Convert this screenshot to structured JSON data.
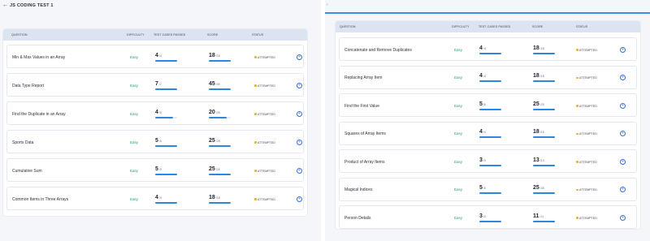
{
  "accent": "#2f86de",
  "header": {
    "back_icon": "arrow-left-icon",
    "title": "JS CODING TEST 1"
  },
  "columns": {
    "question": "QUESTION",
    "difficulty": "DIFFICULTY",
    "test_cases": "TEST CASES PASSED",
    "score": "SCORE",
    "status": "STATUS"
  },
  "left_rows": [
    {
      "question": "Min & Max Values in an Array",
      "difficulty": "Easy",
      "passed": "4",
      "total": "/4",
      "score": "18",
      "score_total": "/18",
      "progress": 1.0,
      "status": "ATTEMPTED"
    },
    {
      "question": "Data Type Report",
      "difficulty": "Easy",
      "passed": "7",
      "total": "/7",
      "score": "45",
      "score_total": "/45",
      "progress": 1.0,
      "status": "ATTEMPTED"
    },
    {
      "question": "Find the Duplicate in an Array",
      "difficulty": "Easy",
      "passed": "4",
      "total": "/5",
      "score": "20",
      "score_total": "/25",
      "progress": 0.8,
      "status": "ATTEMPTED"
    },
    {
      "question": "Sports Data",
      "difficulty": "Easy",
      "passed": "5",
      "total": "/5",
      "score": "25",
      "score_total": "/25",
      "progress": 1.0,
      "status": "ATTEMPTED"
    },
    {
      "question": "Cumulative Sum",
      "difficulty": "Easy",
      "passed": "5",
      "total": "/5",
      "score": "25",
      "score_total": "/25",
      "progress": 1.0,
      "status": "ATTEMPTED"
    },
    {
      "question": "Common Items in Three Arrays",
      "difficulty": "Easy",
      "passed": "4",
      "total": "/4",
      "score": "18",
      "score_total": "/18",
      "progress": 1.0,
      "status": "ATTEMPTED"
    }
  ],
  "right_rows": [
    {
      "question": "Concatenate and Remove Duplicates",
      "difficulty": "Easy",
      "passed": "4",
      "total": "/4",
      "score": "18",
      "score_total": "/18",
      "progress": 1.0,
      "status": "ATTEMPTED"
    },
    {
      "question": "Replacing Array Item",
      "difficulty": "Easy",
      "passed": "4",
      "total": "/4",
      "score": "18",
      "score_total": "/18",
      "progress": 1.0,
      "status": "ATTEMPTED"
    },
    {
      "question": "Find the First Value",
      "difficulty": "Easy",
      "passed": "5",
      "total": "/5",
      "score": "25",
      "score_total": "/25",
      "progress": 1.0,
      "status": "ATTEMPTED"
    },
    {
      "question": "Squares of Array Items",
      "difficulty": "Easy",
      "passed": "4",
      "total": "/4",
      "score": "18",
      "score_total": "/18",
      "progress": 1.0,
      "status": "ATTEMPTED"
    },
    {
      "question": "Product of Array Items",
      "difficulty": "Easy",
      "passed": "3",
      "total": "/3",
      "score": "13",
      "score_total": "/13",
      "progress": 1.0,
      "status": "ATTEMPTED"
    },
    {
      "question": "Magical Indices",
      "difficulty": "Easy",
      "passed": "5",
      "total": "/5",
      "score": "25",
      "score_total": "/25",
      "progress": 1.0,
      "status": "ATTEMPTED"
    },
    {
      "question": "Person Details",
      "difficulty": "Easy",
      "passed": "3",
      "total": "/3",
      "score": "11",
      "score_total": "/11",
      "progress": 1.0,
      "status": "ATTEMPTED"
    }
  ]
}
